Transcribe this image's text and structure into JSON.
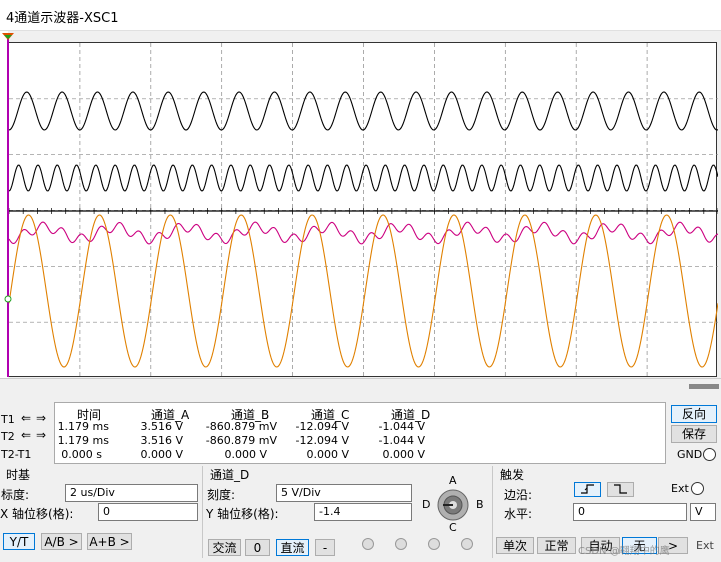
{
  "window": {
    "title": "4通道示波器-XSC1"
  },
  "measurements": {
    "cursor_rows": [
      "T1",
      "T2",
      "T2-T1"
    ],
    "headers": [
      "时间",
      "通道_A",
      "通道_B",
      "通道_C",
      "通道_D"
    ],
    "rows": [
      [
        "1.179 ms",
        "3.516 V",
        "-860.879 mV",
        "-12.094 V",
        "-1.044 V"
      ],
      [
        "1.179 ms",
        "3.516 V",
        "-860.879 mV",
        "-12.094 V",
        "-1.044 V"
      ],
      [
        "0.000 s",
        "0.000 V",
        "0.000 V",
        "0.000 V",
        "0.000 V"
      ]
    ]
  },
  "side_buttons": {
    "reverse": "反向",
    "save": "保存",
    "gnd": "GND"
  },
  "timebase": {
    "title": "时基",
    "scale_label": "标度:",
    "scale_value": "2 us/Div",
    "xpos_label": "X 轴位移(格):",
    "xpos_value": "0",
    "modes": [
      "Y/T",
      "A/B >",
      "A+B >"
    ]
  },
  "channel": {
    "title": "通道_D",
    "scale_label": "刻度:",
    "scale_value": "5  V/Div",
    "ypos_label": "Y 轴位移(格):",
    "ypos_value": "-1.4",
    "coupling": [
      "交流",
      "0",
      "直流",
      "-"
    ],
    "selector": {
      "a": "A",
      "b": "B",
      "c": "C",
      "d": "D"
    }
  },
  "trigger": {
    "title": "触发",
    "edge_label": "边沿:",
    "ext_label": "Ext",
    "level_label": "水平:",
    "level_value": "0",
    "level_unit": "V",
    "modes": [
      "单次",
      "正常",
      "自动",
      "无",
      "Ext"
    ],
    "watermark": "CSDN @翱翔中的鹰"
  },
  "colors": {
    "trace_a": "#000000",
    "trace_b": "#000000",
    "trace_c": "#cc0080",
    "trace_d": "#e08000",
    "grid": "#888888",
    "cursor": "#b000b0",
    "accent": "#0078d7"
  }
}
